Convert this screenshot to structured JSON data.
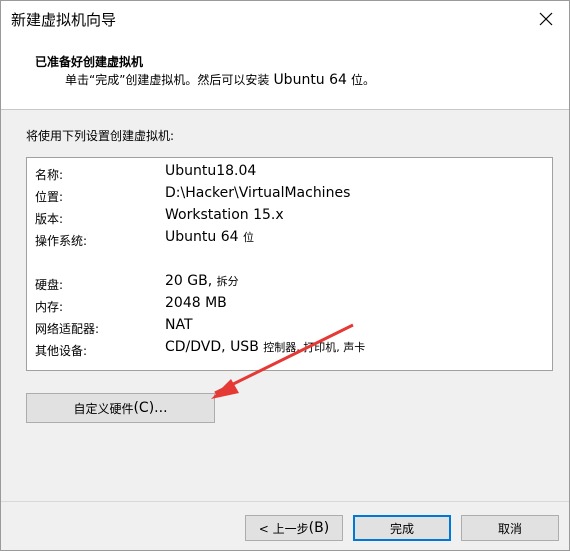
{
  "window": {
    "title": "新建虚拟机向导"
  },
  "header": {
    "title": "已准备好创建虚拟机",
    "subtitle_prefix": "单击“完成”创建虚拟机。然后可以安装",
    "subtitle_os": "Ubuntu 64",
    "subtitle_suffix": "位。"
  },
  "intro": "将使用下列设置创建虚拟机:",
  "summary": {
    "rows": [
      {
        "label": "名称:",
        "value": "Ubuntu18.04",
        "extra": ""
      },
      {
        "label": "位置:",
        "value": "D:\\Hacker\\VirtualMachines",
        "extra": ""
      },
      {
        "label": "版本:",
        "value": "Workstation 15.x",
        "extra": ""
      },
      {
        "label": "操作系统:",
        "value": "Ubuntu 64",
        "extra": "位"
      },
      {
        "label": "硬盘:",
        "value": "20 GB,",
        "extra": "拆分"
      },
      {
        "label": "内存:",
        "value": "2048 MB",
        "extra": ""
      },
      {
        "label": "网络适配器:",
        "value": "NAT",
        "extra": ""
      },
      {
        "label": "其他设备:",
        "value": "CD/DVD, USB",
        "extra": "控制器, 打印机, 声卡"
      }
    ]
  },
  "buttons": {
    "customize_prefix": "自定义硬件",
    "customize_key": "(C)...",
    "back_prefix": "< 上一步",
    "back_key": "(B)",
    "finish": "完成",
    "cancel": "取消"
  },
  "colors": {
    "arrow": "#e53935",
    "primary_border": "#0078d7"
  },
  "icons": {
    "close": "close-icon",
    "annotation": "red-arrow-annotation"
  }
}
